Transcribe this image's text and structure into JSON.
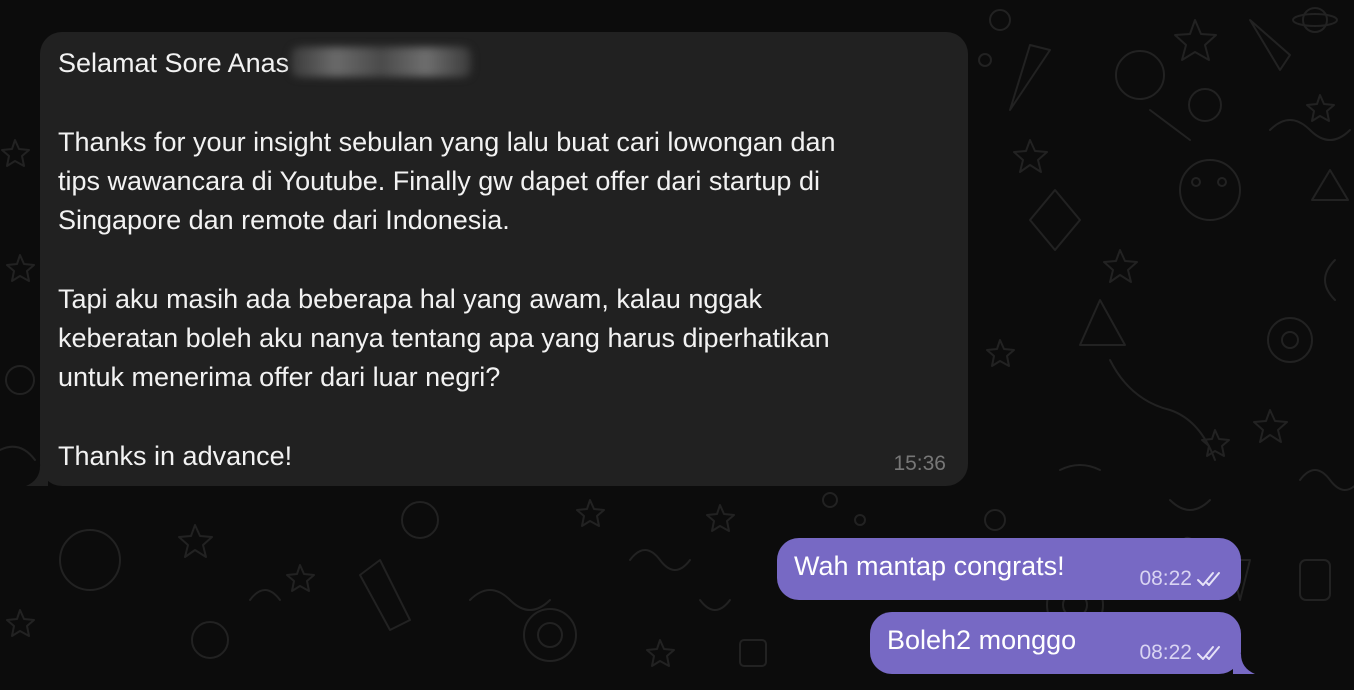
{
  "incoming_message": {
    "lines": [
      "Selamat Sore Anas",
      "",
      "Thanks for your insight sebulan yang lalu buat cari lowongan dan",
      "tips wawancara di Youtube. Finally gw dapet offer dari startup di",
      "Singapore dan remote dari Indonesia.",
      "",
      "Tapi aku masih ada beberapa hal yang awam, kalau nggak",
      "keberatan boleh aku nanya tentang apa yang harus diperhatikan",
      "untuk menerima offer dari luar negri?",
      "",
      "Thanks in advance!"
    ],
    "time": "15:36"
  },
  "outgoing_messages": [
    {
      "text": "Wah mantap congrats!",
      "time": "08:22",
      "status_icon": "double-check-icon"
    },
    {
      "text": "Boleh2 monggo",
      "time": "08:22",
      "status_icon": "double-check-icon"
    }
  ],
  "colors": {
    "background": "#0c0c0c",
    "incoming_bubble": "#212121",
    "outgoing_bubble": "#7769c4",
    "timestamp_incoming": "#777777",
    "timestamp_outgoing": "#d9d4f2"
  }
}
